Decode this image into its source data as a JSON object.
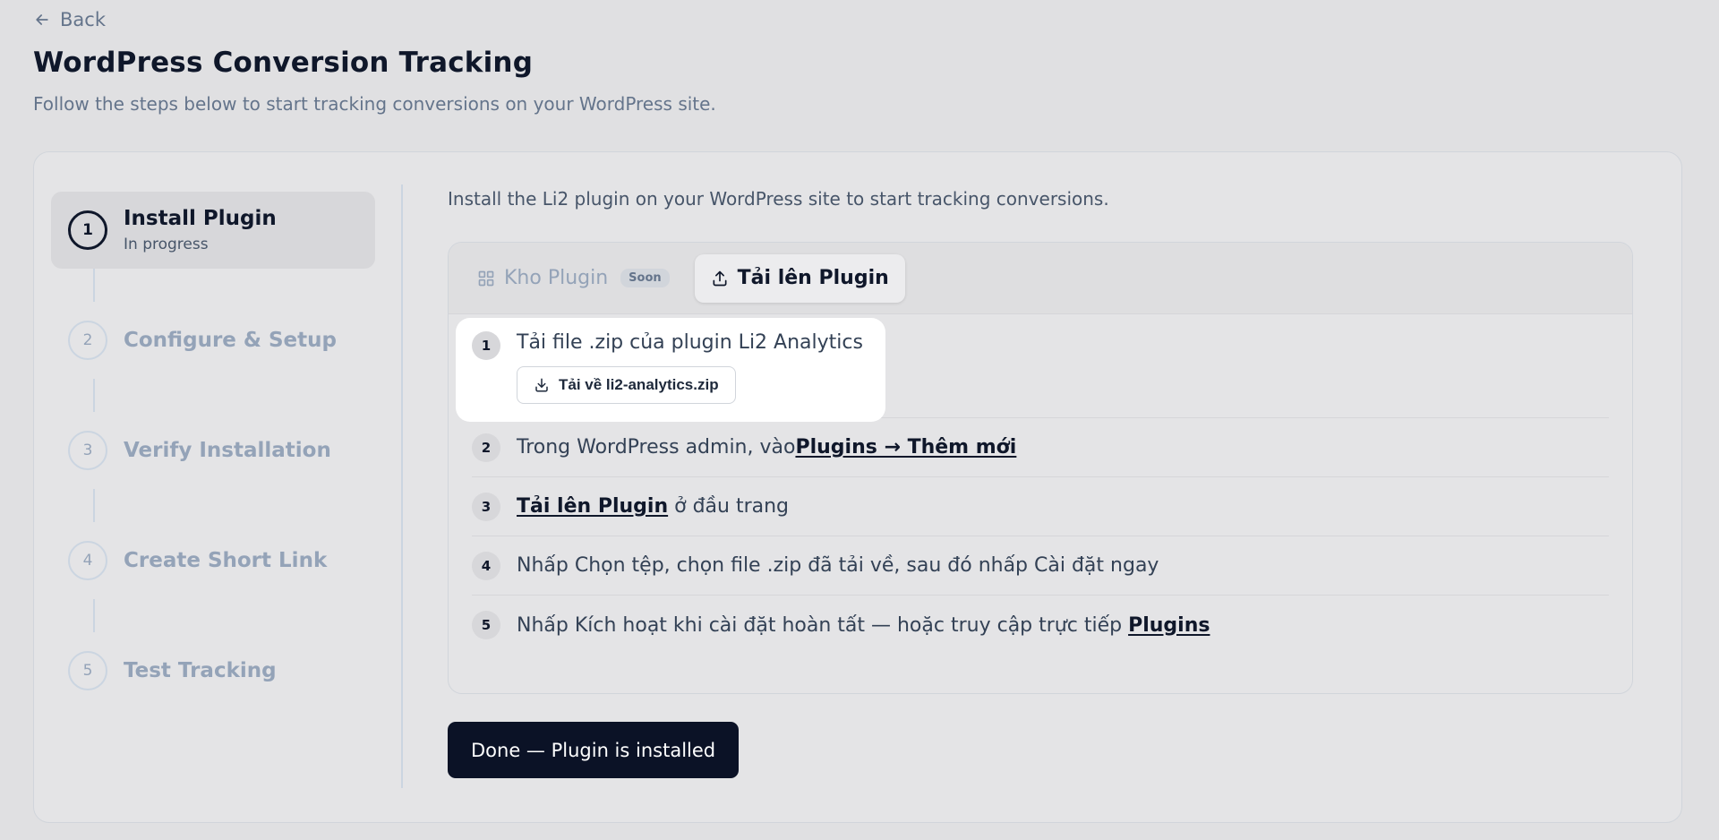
{
  "header": {
    "back_label": "Back",
    "title": "WordPress Conversion Tracking",
    "subtitle": "Follow the steps below to start tracking conversions on your WordPress site."
  },
  "stepper": {
    "steps": [
      {
        "num": "1",
        "label": "Install Plugin",
        "status": "In progress",
        "active": true
      },
      {
        "num": "2",
        "label": "Configure & Setup"
      },
      {
        "num": "3",
        "label": "Verify Installation"
      },
      {
        "num": "4",
        "label": "Create Short Link"
      },
      {
        "num": "5",
        "label": "Test Tracking"
      }
    ]
  },
  "content": {
    "intro": "Install the Li2 plugin on your WordPress site to start tracking conversions.",
    "tabs": [
      {
        "label": "Kho Plugin",
        "badge": "Soon",
        "icon": "grid-icon",
        "disabled": true
      },
      {
        "label": "Tải lên Plugin",
        "icon": "upload-icon",
        "active": true
      }
    ],
    "instructions": [
      {
        "num": "1",
        "text": "Tải file .zip của plugin Li2 Analytics",
        "button": "Tải về li2-analytics.zip"
      },
      {
        "num": "2",
        "text": "Trong WordPress admin, vào ",
        "link": "Plugins → Thêm mới"
      },
      {
        "num": "3",
        "link": "Tải lên Plugin",
        "text_after": " ở đầu trang"
      },
      {
        "num": "4",
        "text": "Nhấp Chọn tệp, chọn file .zip đã tải về, sau đó nhấp Cài đặt ngay"
      },
      {
        "num": "5",
        "text": "Nhấp Kích hoạt khi cài đặt hoàn tất — hoặc truy cập trực tiếp ",
        "link": "Plugins"
      }
    ],
    "done_label": "Done — Plugin is installed"
  },
  "colors": {
    "background": "#e0e0e2",
    "primary_button": "#0b1226",
    "text_primary": "#0f172a",
    "text_muted": "#94a3b8"
  }
}
